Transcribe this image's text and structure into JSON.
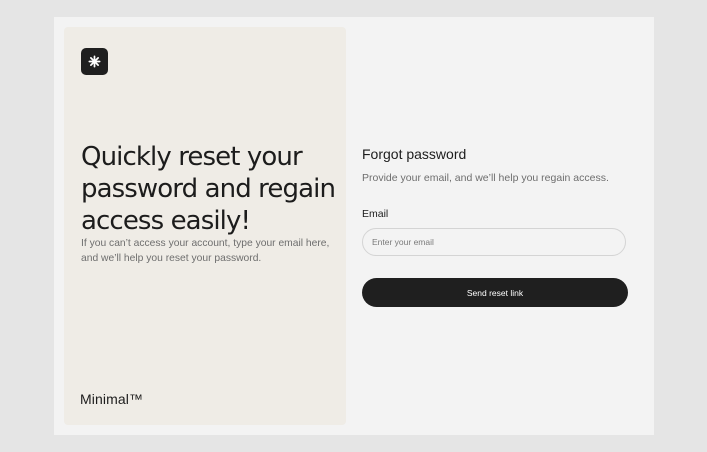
{
  "left_panel": {
    "logo_icon": "asterisk-icon",
    "headline": "Quickly reset your password and regain access easily!",
    "subtext": "If you can’t access your account, type your email here, and we’ll help you reset your password.",
    "brand": "Minimal™"
  },
  "form": {
    "title": "Forgot password",
    "subtitle": "Provide your email, and we’ll help you regain access.",
    "email_label": "Email",
    "email_placeholder": "Enter your email",
    "email_value": "",
    "submit_label": "Send reset link"
  },
  "colors": {
    "background": "#e5e5e5",
    "card": "#f3f3f3",
    "left_panel": "#efece6",
    "primary": "#1f1f1f",
    "muted_text": "#6e6e6e"
  }
}
